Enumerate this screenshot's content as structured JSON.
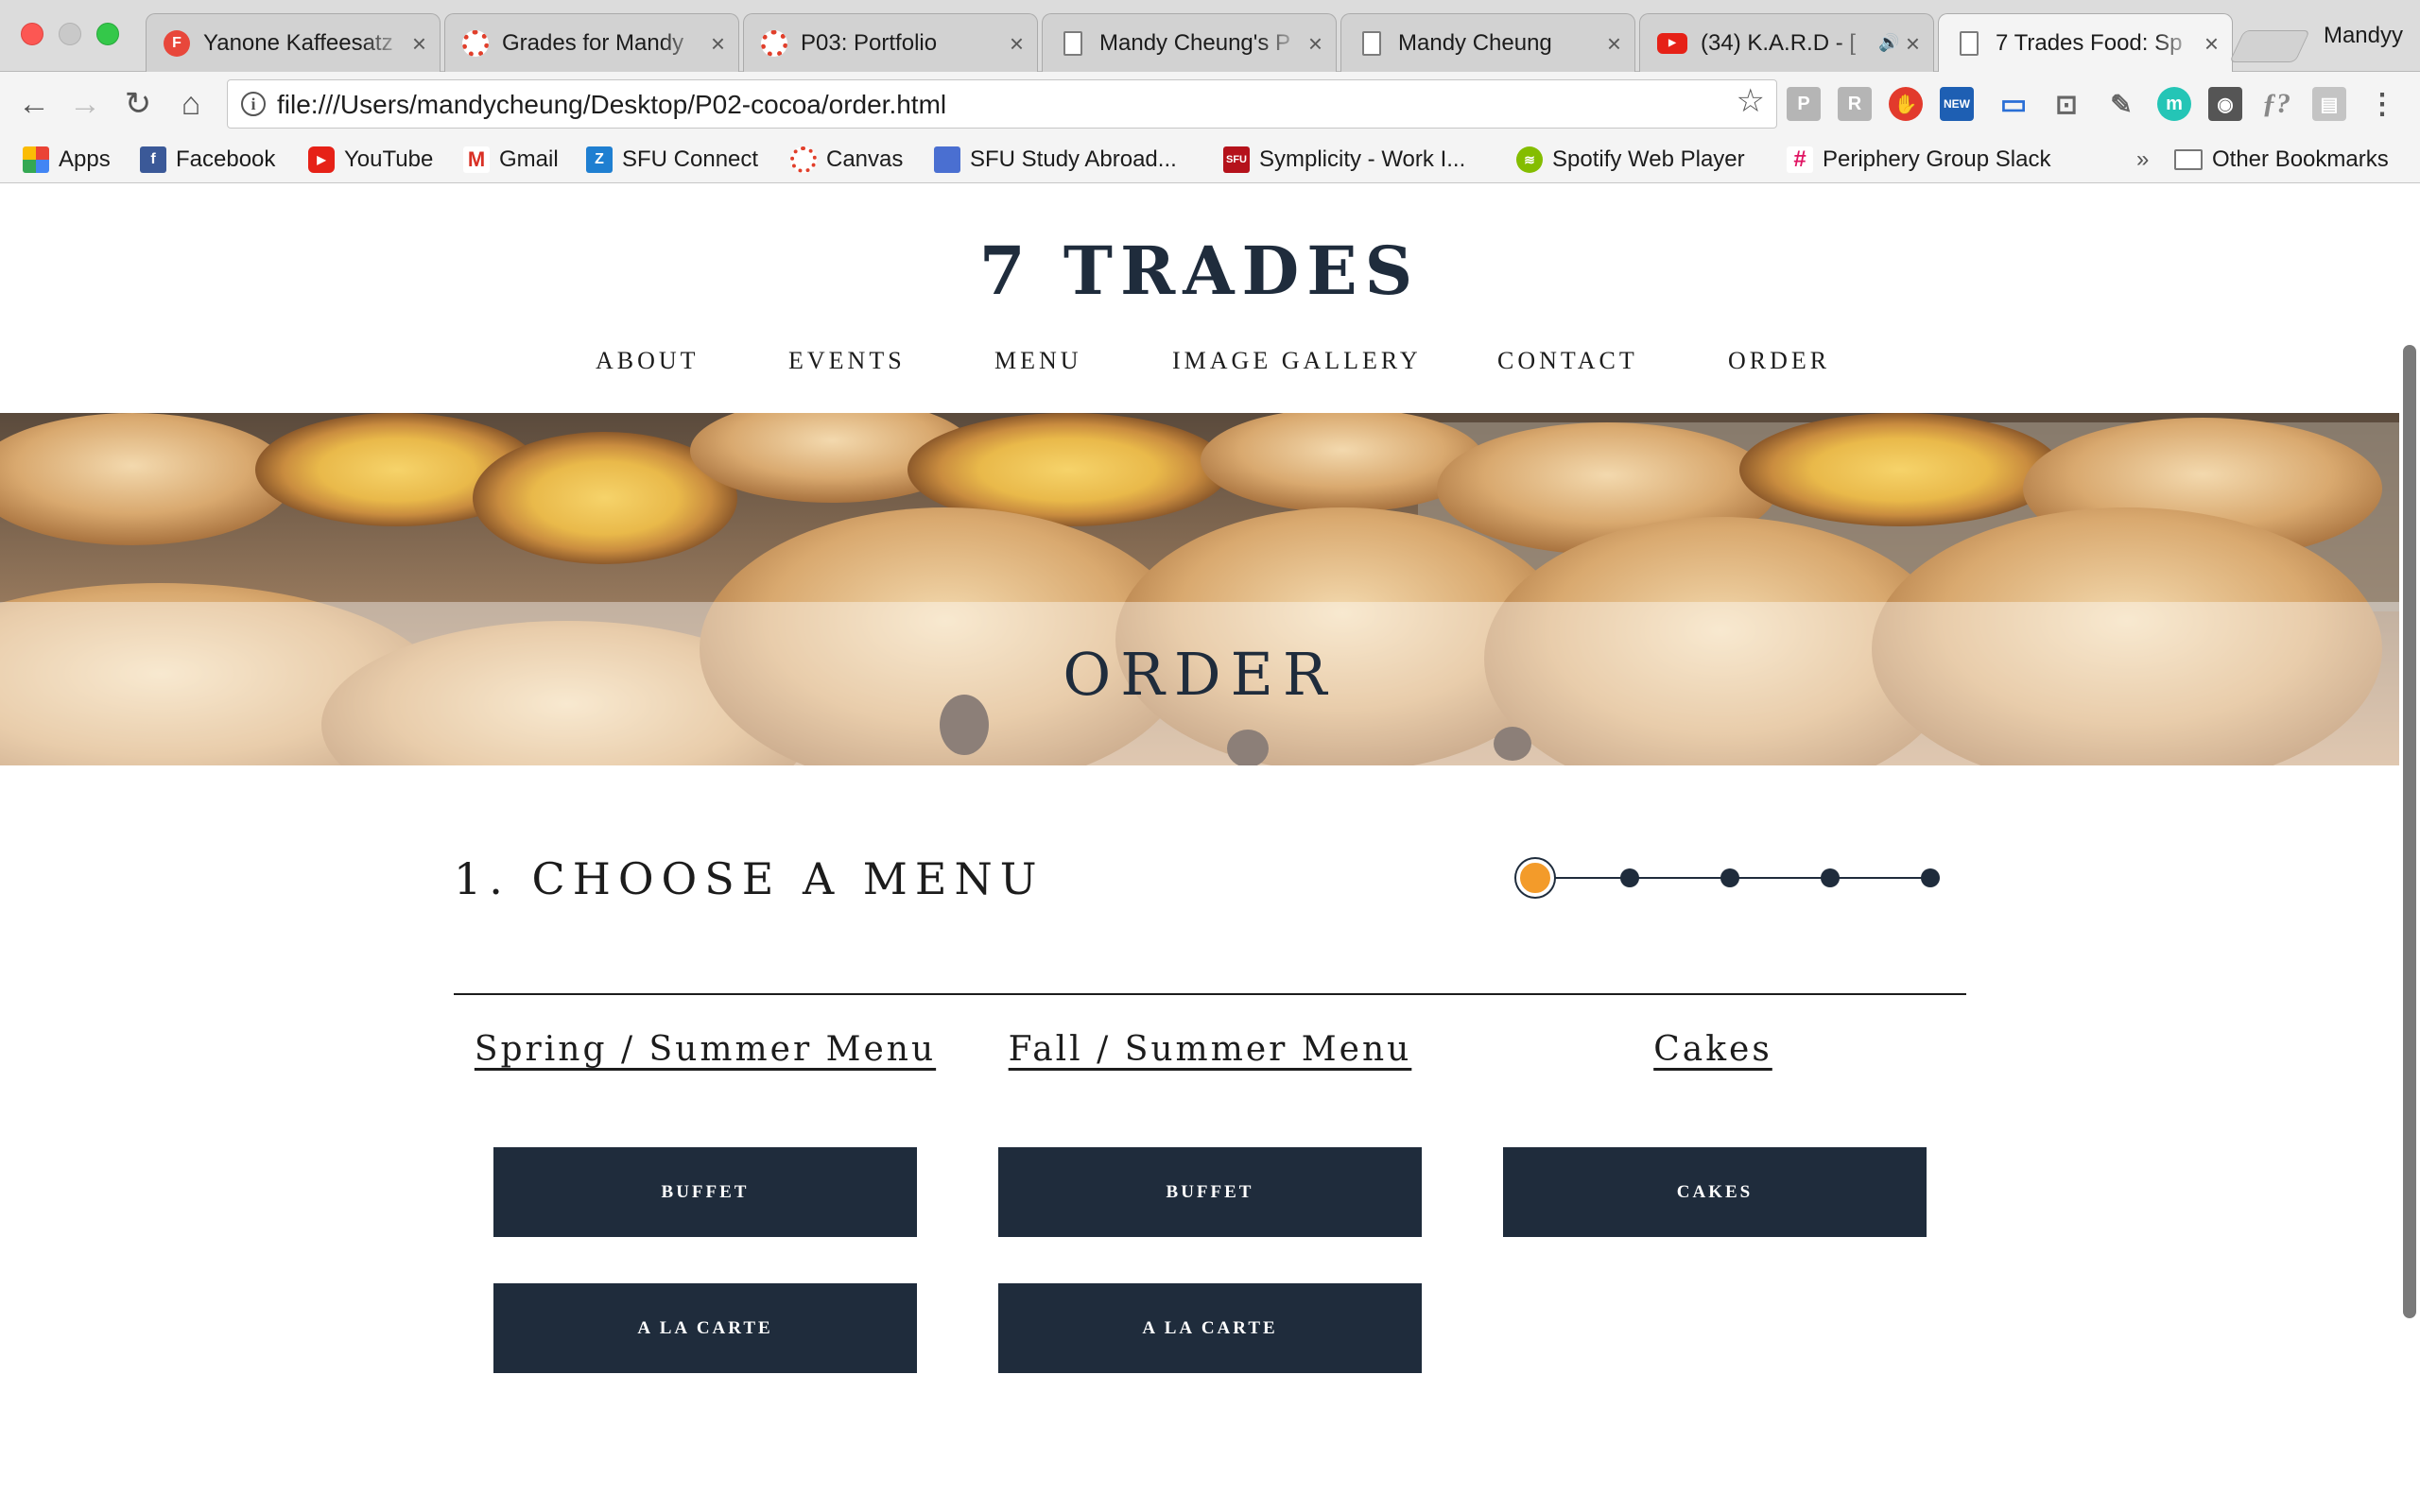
{
  "browser": {
    "tabs": [
      {
        "title": "Yanone Kaffeesatz",
        "favicon": "f-icon",
        "active": false
      },
      {
        "title": "Grades for Mandy",
        "favicon": "canvas-icon",
        "active": false
      },
      {
        "title": "P03: Portfolio",
        "favicon": "canvas-icon",
        "active": false
      },
      {
        "title": "Mandy Cheung's P",
        "favicon": "document-icon",
        "active": false
      },
      {
        "title": "Mandy Cheung",
        "favicon": "document-icon",
        "active": false
      },
      {
        "title": "(34) K.A.R.D - [",
        "favicon": "youtube-icon",
        "active": false,
        "audio": "🔊"
      },
      {
        "title": "7 Trades Food: Sp",
        "favicon": "document-icon",
        "active": true
      }
    ],
    "close_glyph": "×",
    "profile_name": "Mandyy",
    "url": "file:///Users/mandycheung/Desktop/P02-cocoa/order.html",
    "bookmarks": [
      {
        "label": "Apps",
        "icon": "apps-grid-icon"
      },
      {
        "label": "Facebook",
        "icon": "facebook-icon"
      },
      {
        "label": "YouTube",
        "icon": "youtube-icon"
      },
      {
        "label": "Gmail",
        "icon": "gmail-icon"
      },
      {
        "label": "SFU Connect",
        "icon": "sfu-connect-icon"
      },
      {
        "label": "Canvas",
        "icon": "canvas-icon"
      },
      {
        "label": "SFU Study Abroad...",
        "icon": "bookmark-icon"
      },
      {
        "label": "Symplicity - Work I...",
        "icon": "sfu-icon"
      },
      {
        "label": "Spotify Web Player",
        "icon": "spotify-icon"
      },
      {
        "label": "Periphery Group Slack",
        "icon": "slack-icon"
      }
    ],
    "bookmarks_overflow": "»",
    "other_bookmarks": "Other Bookmarks"
  },
  "site": {
    "brand": "7 TRADES",
    "nav": [
      "ABOUT",
      "EVENTS",
      "MENU",
      "IMAGE GALLERY",
      "CONTACT",
      "ORDER"
    ],
    "hero_title": "ORDER",
    "step_title": "1. CHOOSE A MENU",
    "stepper": {
      "total_steps": 5,
      "current_step": 1
    },
    "columns": [
      {
        "heading": "Spring / Summer Menu",
        "buttons": [
          "BUFFET",
          "A LA CARTE"
        ]
      },
      {
        "heading": "Fall / Summer Menu",
        "buttons": [
          "BUFFET",
          "A LA CARTE"
        ]
      },
      {
        "heading": "Cakes",
        "buttons": [
          "CAKES"
        ]
      }
    ]
  },
  "colors": {
    "navy": "#1f2c3c",
    "step_active": "#f39b2a",
    "pastry": "#d8b48a"
  }
}
